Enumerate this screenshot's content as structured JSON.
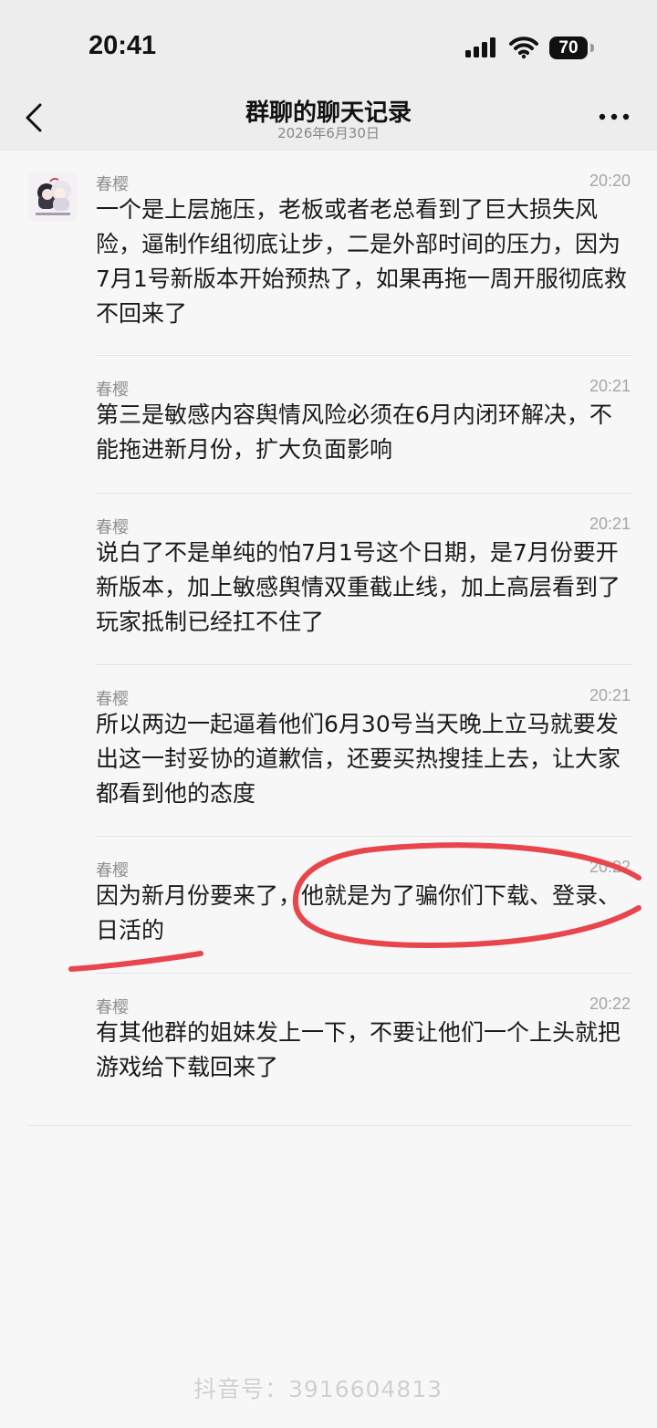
{
  "status_bar": {
    "time": "20:41",
    "battery": "70"
  },
  "nav": {
    "title": "群聊的聊天记录",
    "subtitle": "2026年6月30日"
  },
  "messages": [
    {
      "sender": "春樱",
      "time": "20:20",
      "text": "一个是上层施压，老板或者老总看到了巨大损失风险，逼制作组彻底让步，二是外部时间的压力，因为7月1号新版本开始预热了，如果再拖一周开服彻底救不回来了"
    },
    {
      "sender": "春樱",
      "time": "20:21",
      "text": "第三是敏感内容舆情风险必须在6月内闭环解决，不能拖进新月份，扩大负面影响"
    },
    {
      "sender": "春樱",
      "time": "20:21",
      "text": "说白了不是单纯的怕7月1号这个日期，是7月份要开新版本，加上敏感舆情双重截止线，加上高层看到了玩家抵制已经扛不住了"
    },
    {
      "sender": "春樱",
      "time": "20:21",
      "text": "所以两边一起逼着他们6月30号当天晚上立马就要发出这一封妥协的道歉信，还要买热搜挂上去，让大家都看到他的态度"
    },
    {
      "sender": "春樱",
      "time": "20:22",
      "text": "因为新月份要来了，他就是为了骗你们下载、登录、日活的"
    },
    {
      "sender": "春樱",
      "time": "20:22",
      "text": "有其他群的姐妹发上一下，不要让他们一个上头就把游戏给下载回来了"
    }
  ],
  "watermark": "抖音号：3916604813",
  "colors": {
    "annotation": "#e8454d"
  }
}
